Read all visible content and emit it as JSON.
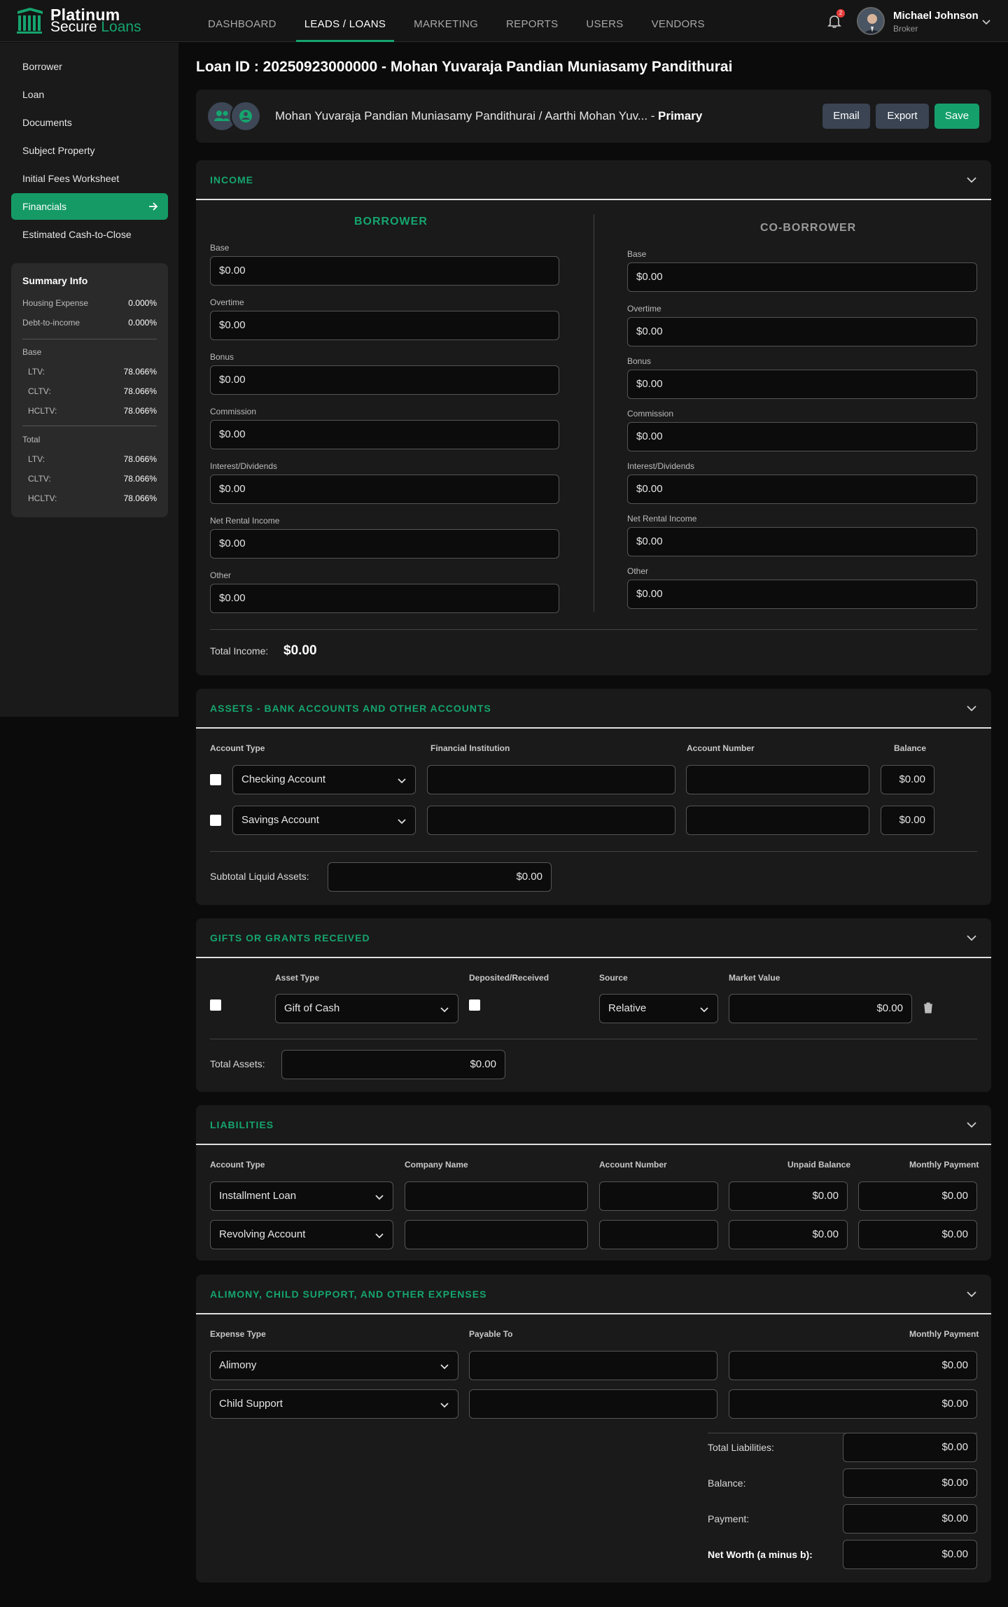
{
  "brand": {
    "line1": "Platinum",
    "line2a": "Secure ",
    "line2b": "Loans"
  },
  "nav": [
    "DASHBOARD",
    "LEADS / LOANS",
    "MARKETING",
    "REPORTS",
    "USERS",
    "VENDORS"
  ],
  "notifications": {
    "count": "2"
  },
  "user": {
    "name": "Michael Johnson",
    "role": "Broker"
  },
  "sidebar": {
    "items": [
      "Borrower",
      "Loan",
      "Documents",
      "Subject Property",
      "Initial Fees Worksheet",
      "Financials",
      "Estimated Cash-to-Close"
    ],
    "active": "Financials"
  },
  "summary": {
    "title": "Summary Info",
    "housing_label": "Housing Expense",
    "housing_value": "0.000%",
    "dti_label": "Debt-to-income",
    "dti_value": "0.000%",
    "base_label": "Base",
    "base": [
      {
        "k": "LTV:",
        "v": "78.066%"
      },
      {
        "k": "CLTV:",
        "v": "78.066%"
      },
      {
        "k": "HCLTV:",
        "v": "78.066%"
      }
    ],
    "total_label": "Total",
    "total": [
      {
        "k": "LTV:",
        "v": "78.066%"
      },
      {
        "k": "CLTV:",
        "v": "78.066%"
      },
      {
        "k": "HCLTV:",
        "v": "78.066%"
      }
    ]
  },
  "page": {
    "title": "Loan ID : 20250923000000 - Mohan Yuvaraja Pandian Muniasamy Pandithurai"
  },
  "header": {
    "names": "Mohan Yuvaraja Pandian Muniasamy Pandithurai / Aarthi Mohan Yuv... -",
    "primary": "Primary",
    "email": "Email",
    "export": "Export",
    "save": "Save"
  },
  "income": {
    "title": "INCOME",
    "borrower_title": "BORROWER",
    "coborrower_title": "CO-BORROWER",
    "borrower": [
      {
        "label": "Base",
        "value": "$0.00"
      },
      {
        "label": "Overtime",
        "value": "$0.00"
      },
      {
        "label": "Bonus",
        "value": "$0.00"
      },
      {
        "label": "Commission",
        "value": "$0.00"
      },
      {
        "label": "Interest/Dividends",
        "value": "$0.00"
      },
      {
        "label": "Net Rental Income",
        "value": "$0.00"
      },
      {
        "label": "Other",
        "value": "$0.00"
      }
    ],
    "coborrower": [
      {
        "label": "Base",
        "value": "$0.00"
      },
      {
        "label": "Overtime",
        "value": "$0.00"
      },
      {
        "label": "Bonus",
        "value": "$0.00"
      },
      {
        "label": "Commission",
        "value": "$0.00"
      },
      {
        "label": "Interest/Dividends",
        "value": "$0.00"
      },
      {
        "label": "Net Rental Income",
        "value": "$0.00"
      },
      {
        "label": "Other",
        "value": "$0.00"
      }
    ],
    "total_label": "Total Income:",
    "total_value": "$0.00"
  },
  "assets": {
    "title": "ASSETS - BANK ACCOUNTS AND OTHER ACCOUNTS",
    "headers": [
      "Account Type",
      "Financial Institution",
      "Account Number",
      "Balance"
    ],
    "rows": [
      {
        "type": "Checking Account",
        "institution": "",
        "number": "",
        "balance": "$0.00"
      },
      {
        "type": "Savings Account",
        "institution": "",
        "number": "",
        "balance": "$0.00"
      }
    ],
    "subtotal_label": "Subtotal Liquid Assets:",
    "subtotal_value": "$0.00"
  },
  "gifts": {
    "title": "GIFTS OR GRANTS RECEIVED",
    "headers": [
      "Asset Type",
      "Deposited/Received",
      "Source",
      "Market Value"
    ],
    "row": {
      "type": "Gift of Cash",
      "source": "Relative",
      "value": "$0.00"
    },
    "total_label": "Total Assets:",
    "total_value": "$0.00"
  },
  "liabilities": {
    "title": "LIABILITIES",
    "headers": [
      "Account Type",
      "Company Name",
      "Account Number",
      "Unpaid Balance",
      "Monthly Payment"
    ],
    "rows": [
      {
        "type": "Installment Loan",
        "company": "",
        "number": "",
        "unpaid": "$0.00",
        "payment": "$0.00"
      },
      {
        "type": "Revolving Account",
        "company": "",
        "number": "",
        "unpaid": "$0.00",
        "payment": "$0.00"
      }
    ]
  },
  "expenses": {
    "title": "ALIMONY, CHILD SUPPORT, AND OTHER EXPENSES",
    "headers": [
      "Expense Type",
      "Payable To",
      "Monthly Payment"
    ],
    "rows": [
      {
        "type": "Alimony",
        "payable": "",
        "payment": "$0.00"
      },
      {
        "type": "Child Support",
        "payable": "",
        "payment": "$0.00"
      }
    ],
    "totals": [
      {
        "label": "Total Liabilities:",
        "value": "$0.00"
      },
      {
        "label": "Balance:",
        "value": "$0.00"
      },
      {
        "label": "Payment:",
        "value": "$0.00"
      },
      {
        "label": "Net Worth (a minus b):",
        "value": "$0.00"
      }
    ]
  },
  "colors": {
    "accent": "#15a56e",
    "background": "#0b0b0b",
    "card": "#1a1a1a"
  }
}
